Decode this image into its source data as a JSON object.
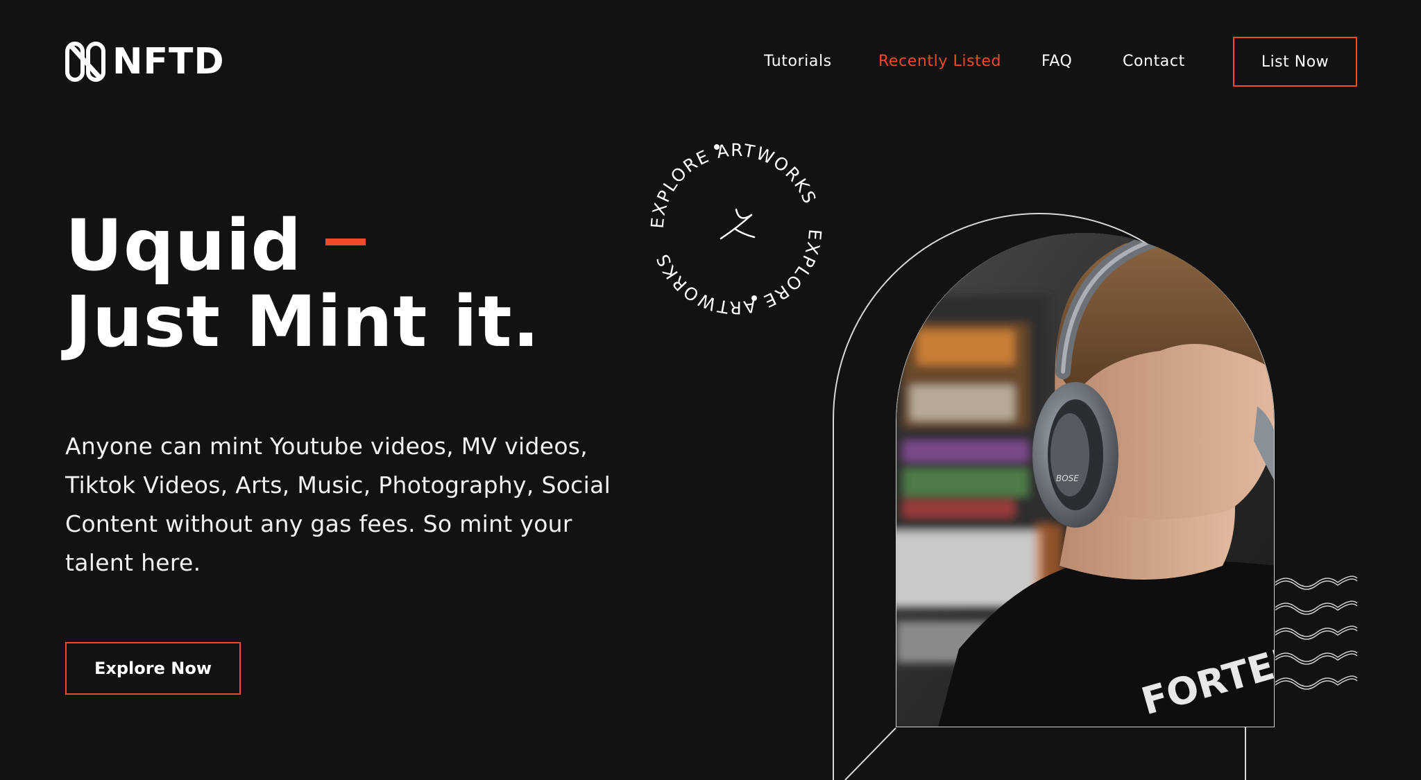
{
  "brand": {
    "name": "NFTD",
    "logo_icon": "nftd-logo-icon"
  },
  "nav": {
    "items": [
      {
        "label": "Tutorials",
        "active": false
      },
      {
        "label": "Recently Listed",
        "active": true
      },
      {
        "label": "FAQ",
        "active": false
      },
      {
        "label": "Contact",
        "active": false
      }
    ],
    "cta_label": "List Now"
  },
  "hero": {
    "title_line1": "Uquid",
    "title_line2": "Just Mint it.",
    "description": "Anyone can mint Youtube videos, MV videos, Tiktok Videos, Arts, Music, Photography, Social Content without any gas fees. So mint your talent here.",
    "cta_label": "Explore Now"
  },
  "badge": {
    "text": "EXPLORE ARTWORKS",
    "icon": "arrow-up-right-icon"
  },
  "photo": {
    "description_icon": "person-headphones-photo",
    "shirt_text": "FORTEM",
    "headphone_brand": "BOSE"
  },
  "colors": {
    "background": "#121212",
    "accent": "#f24a2a",
    "text": "#ffffff"
  }
}
